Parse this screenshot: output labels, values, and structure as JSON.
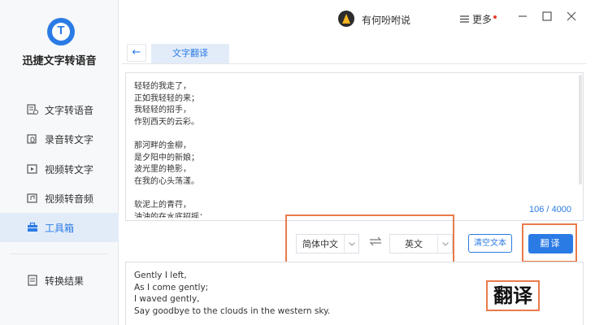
{
  "app": {
    "name": "迅捷文字转语音",
    "logo_letter": "T"
  },
  "sidebar": {
    "items": [
      {
        "label": "文字转语音",
        "icon": "text-voice-icon"
      },
      {
        "label": "录音转文字",
        "icon": "record-icon"
      },
      {
        "label": "视频转文字",
        "icon": "video-icon"
      },
      {
        "label": "视频转音频",
        "icon": "video-audio-icon"
      },
      {
        "label": "工具箱",
        "icon": "toolbox-icon",
        "active": true
      },
      {
        "label": "转换结果",
        "icon": "result-icon"
      }
    ]
  },
  "titlebar": {
    "username": "有何吩咐说",
    "more_label": "更多",
    "menu_icon": "hamburger-icon",
    "buttons": [
      "minimize-icon",
      "maximize-icon",
      "close-icon"
    ]
  },
  "tabs": {
    "back_icon": "arrow-left-icon",
    "active_tab": "文字翻译"
  },
  "source": {
    "text": "轻轻的我走了，\n正如我轻轻的来；\n我轻轻的招手，\n作别西天的云彩。\n\n那河畔的金柳，\n是夕阳中的新娘；\n波光里的艳影，\n在我的心头荡漾。\n\n软泥上的青荇，\n油油的在水底招摇；",
    "count": "106 / 4000"
  },
  "controls": {
    "source_lang": "简体中文",
    "target_lang": "英文",
    "swap_icon": "swap-icon",
    "clear_label": "清空文本",
    "translate_label": "翻译"
  },
  "annotation": {
    "label": "翻译",
    "color": "#e97b4a"
  },
  "output": {
    "text": "Gently I left,\nAs I come gently;\nI waved gently,\nSay goodbye to the clouds in the western sky."
  },
  "colors": {
    "accent": "#2b7be5",
    "sidebar_bg": "#f7f8fa",
    "active_bg": "#e2ecf9"
  }
}
